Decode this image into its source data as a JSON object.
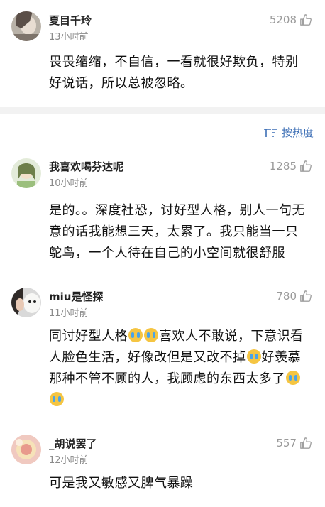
{
  "comments": [
    {
      "username": "夏目千玲",
      "time": "13小时前",
      "likes": "5208",
      "text": "畏畏缩缩，不自信，一看就很好欺负，特别好说话，所以总被忽略。"
    },
    {
      "username": "我喜欢喝芬达呢",
      "time": "10小时前",
      "likes": "1285",
      "text": "是的。。深度社恐，讨好型人格，别人一句无意的话我能想三天，太累了。我只能当一只鸵鸟，一个人待在自己的小空间就很舒服"
    },
    {
      "username": "miu是怪探",
      "time": "11小时前",
      "likes": "780",
      "text_parts": [
        "同讨好型人格",
        "喜欢人不敢说，下意识看人脸色生活，好像改但是又改不掉",
        "好羡慕那种不管不顾的人，我顾虑的东西太多了"
      ]
    },
    {
      "username": "_胡说罢了",
      "time": "12小时前",
      "likes": "557",
      "text": "可是我又敏感又脾气暴躁"
    }
  ],
  "sort": {
    "label": "按热度",
    "icon": "sort-icon"
  },
  "colors": {
    "accent": "#3d6fb6",
    "meta": "#8a8a8a",
    "divider": "#f2f2f2"
  }
}
